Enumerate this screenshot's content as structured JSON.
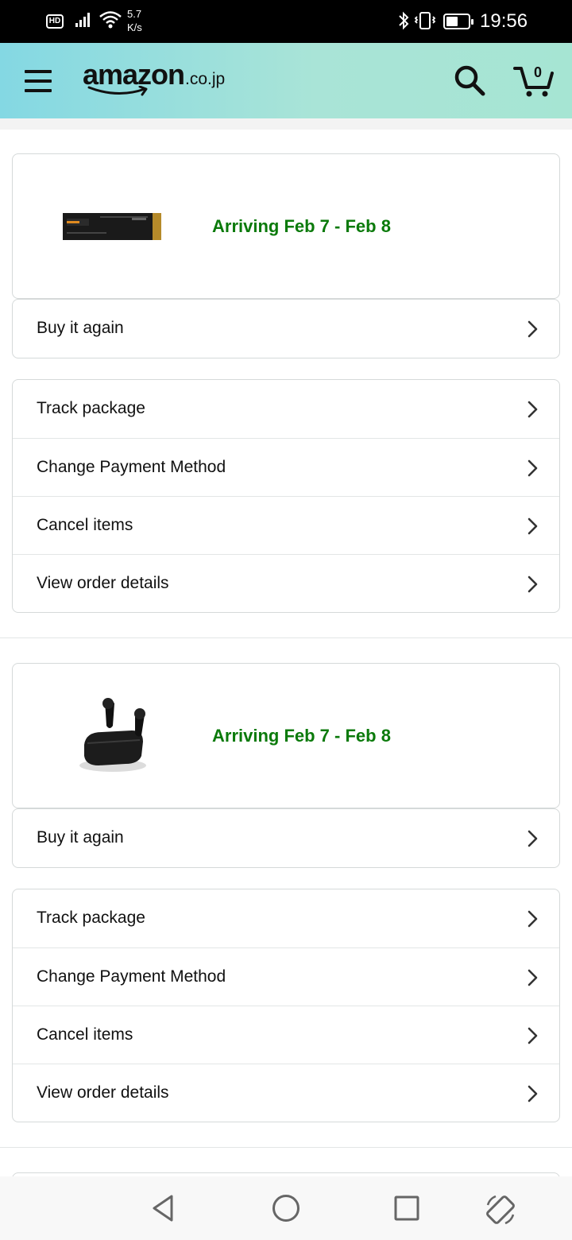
{
  "status_bar": {
    "network_badge": "HD",
    "speed_value": "5.7",
    "speed_unit": "K/s",
    "time": "19:56",
    "battery_level": 0.55,
    "icons": [
      "hd-icon",
      "signal-icon",
      "wifi-icon",
      "bluetooth-icon",
      "vibrate-icon",
      "battery-icon"
    ]
  },
  "header": {
    "logo_word": "amazon",
    "logo_suffix": ".co.jp",
    "cart_count": "0",
    "icons": [
      "menu-icon",
      "search-icon",
      "cart-icon"
    ]
  },
  "orders": [
    {
      "product_image": "samsung-970-evo-ssd",
      "arrival": "Arriving Feb 7 - Feb 8",
      "buy_again": "Buy it again",
      "actions": [
        "Track package",
        "Change Payment Method",
        "Cancel items",
        "View order details"
      ]
    },
    {
      "product_image": "wireless-earbuds",
      "arrival": "Arriving Feb 7 - Feb 8",
      "buy_again": "Buy it again",
      "actions": [
        "Track package",
        "Change Payment Method",
        "Cancel items",
        "View order details"
      ]
    }
  ],
  "navbar": {
    "icons": [
      "back-icon",
      "home-icon",
      "recents-icon",
      "rotate-icon"
    ]
  },
  "colors": {
    "arrival_green": "#0b7a0b",
    "header_gradient_start": "#84d8e3",
    "header_gradient_end": "#a6e5d3"
  }
}
